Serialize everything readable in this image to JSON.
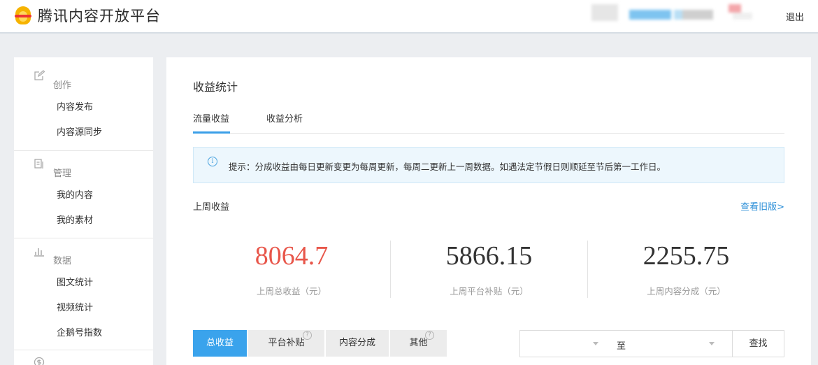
{
  "header": {
    "brand": "腾讯内容开放平台",
    "logout": "退出"
  },
  "sidebar": {
    "groups": [
      {
        "title": "创作",
        "icon": "edit-icon",
        "items": [
          "内容发布",
          "内容源同步"
        ]
      },
      {
        "title": "管理",
        "icon": "manage-icon",
        "items": [
          "我的内容",
          "我的素材"
        ]
      },
      {
        "title": "数据",
        "icon": "chart-icon",
        "items": [
          "图文统计",
          "视频统计",
          "企鹅号指数"
        ]
      }
    ],
    "extra_icon": "money-icon"
  },
  "main": {
    "title": "收益统计",
    "tabs": [
      {
        "label": "流量收益",
        "active": true
      },
      {
        "label": "收益分析",
        "active": false
      }
    ],
    "notice": "提示：分成收益由每日更新变更为每周更新，每周二更新上一周数据。如遇法定节假日则顺延至节后第一工作日。",
    "section_label": "上周收益",
    "old_version_link": "查看旧版>",
    "stats": [
      {
        "value": "8064.7",
        "caption": "上周总收益（元）",
        "highlight": true
      },
      {
        "value": "5866.15",
        "caption": "上周平台补贴（元）",
        "highlight": false
      },
      {
        "value": "2255.75",
        "caption": "上周内容分成（元）",
        "highlight": false
      }
    ],
    "filters": [
      {
        "label": "总收益",
        "active": true,
        "help": false
      },
      {
        "label": "平台补贴",
        "active": false,
        "help": true
      },
      {
        "label": "内容分成",
        "active": false,
        "help": false
      },
      {
        "label": "其他",
        "active": false,
        "help": true
      }
    ],
    "date_range_separator": "至",
    "search_button": "查找"
  },
  "colors": {
    "accent": "#3aa3ec",
    "highlight_value": "#e8564a",
    "link": "#2c8fd8"
  }
}
